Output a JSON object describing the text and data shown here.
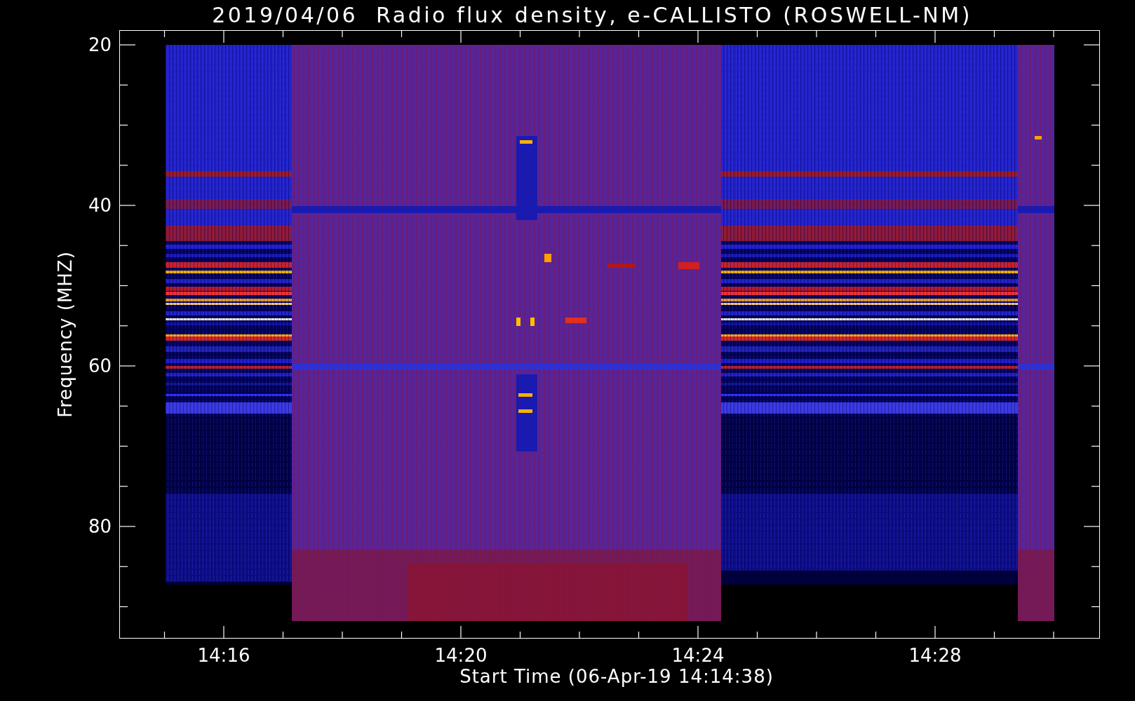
{
  "title": "2019/04/06  Radio flux density, e-CALLISTO (ROSWELL-NM)",
  "y_axis": {
    "label": "Frequency (MHZ)",
    "ticks": [
      "20",
      "40",
      "60",
      "80"
    ]
  },
  "x_axis": {
    "label": "Start Time (06-Apr-19 14:14:38)",
    "ticks": [
      "14:16",
      "14:20",
      "14:24",
      "14:28"
    ]
  }
}
